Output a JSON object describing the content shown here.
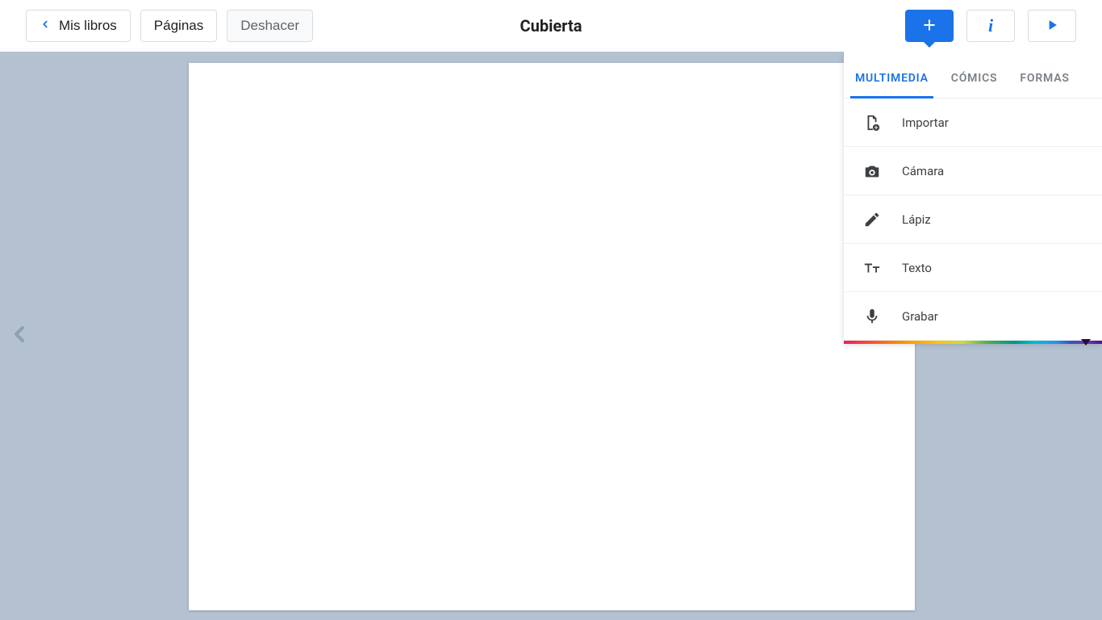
{
  "toolbar": {
    "back_label": "Mis libros",
    "pages_label": "Páginas",
    "undo_label": "Deshacer"
  },
  "title": "Cubierta",
  "header_icons": {
    "add": "add-icon",
    "info": "info-icon",
    "play": "play-icon"
  },
  "panel": {
    "tabs": [
      {
        "label": "MULTIMEDIA",
        "active": true
      },
      {
        "label": "CÓMICS",
        "active": false
      },
      {
        "label": "FORMAS",
        "active": false
      }
    ],
    "items": [
      {
        "label": "Importar",
        "icon": "file-add-icon"
      },
      {
        "label": "Cámara",
        "icon": "camera-icon"
      },
      {
        "label": "Lápiz",
        "icon": "pencil-icon"
      },
      {
        "label": "Texto",
        "icon": "text-size-icon"
      },
      {
        "label": "Grabar",
        "icon": "microphone-icon"
      }
    ]
  },
  "colors": {
    "accent": "#1a73e8",
    "workspace_bg": "#b3c1d1"
  }
}
